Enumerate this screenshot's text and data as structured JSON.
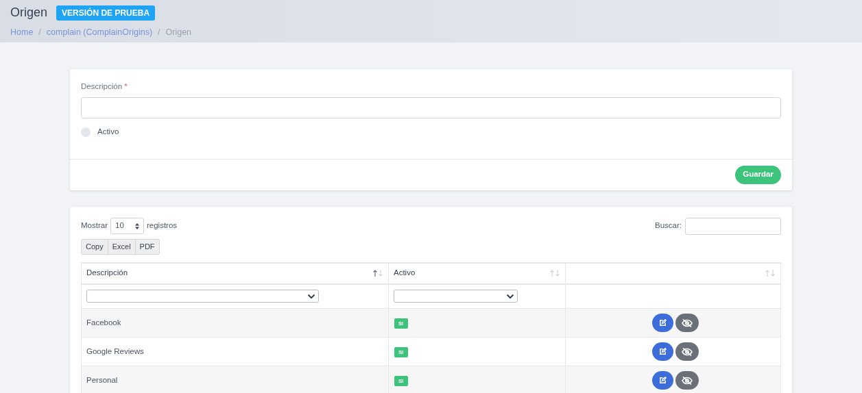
{
  "header": {
    "title": "Origen",
    "badge": "VERSIÓN DE PRUEBA",
    "breadcrumb": [
      {
        "label": "Home",
        "link": true
      },
      {
        "label": "complain (ComplainOrigins)",
        "link": true
      },
      {
        "label": "Origen",
        "link": false
      }
    ],
    "separator": "/"
  },
  "form": {
    "description_label": "Descripción",
    "required_mark": "*",
    "active": {
      "label": "Activo",
      "checked": false
    },
    "save_button": "Guardar"
  },
  "table_card": {
    "show_label": "Mostrar",
    "page_size": "10",
    "records_label": "registros",
    "search_label": "Buscar:",
    "export_buttons": [
      "Copy",
      "Excel",
      "PDF"
    ],
    "columns": [
      {
        "label": "Descripción",
        "sorted": true,
        "filter": true
      },
      {
        "label": "Activo",
        "sorted": false,
        "filter": true
      },
      {
        "sorted": false,
        "filter": false
      }
    ],
    "rows": [
      {
        "description": "Facebook",
        "active": "SI"
      },
      {
        "description": "Google Reviews",
        "active": "SI"
      },
      {
        "description": "Personal",
        "active": "SI"
      }
    ]
  }
}
